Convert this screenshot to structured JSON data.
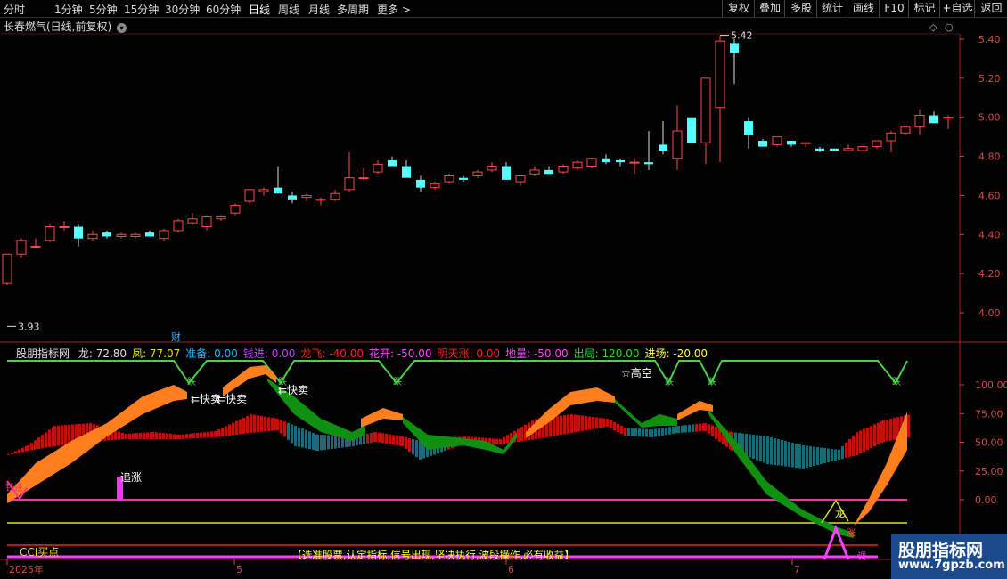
{
  "toolbar": {
    "periods": [
      "分时",
      "1分钟",
      "5分钟",
      "15分钟",
      "30分钟",
      "60分钟",
      "日线",
      "周线",
      "月线",
      "多周期",
      "更多 >"
    ],
    "active_period": "日线",
    "right_buttons": [
      "复权",
      "叠加",
      "多股",
      "统计",
      "画线",
      "F10",
      "标记",
      "+自选",
      "返回"
    ]
  },
  "stock": {
    "title": "长春燃气(日线,前复权)",
    "high_label": "5.42",
    "low_label": "3.93",
    "cai_label": "财"
  },
  "price_axis": [
    "5.40",
    "5.20",
    "5.00",
    "4.80",
    "4.60",
    "4.40",
    "4.20",
    "4.00"
  ],
  "indicator": {
    "name": "股朋指标网",
    "values": [
      {
        "label": "龙: 72.80",
        "color": "#e0e0e0"
      },
      {
        "label": "凤: 77.07",
        "color": "#e0e000"
      },
      {
        "label": "准备: 0.00",
        "color": "#00c0ff"
      },
      {
        "label": "钱进: 0.00",
        "color": "#c040ff"
      },
      {
        "label": "龙飞: -40.00",
        "color": "#ff2020"
      },
      {
        "label": "花开: -50.00",
        "color": "#ff40ff"
      },
      {
        "label": "明天涨: 0.00",
        "color": "#ff2020"
      },
      {
        "label": "地量: -50.00",
        "color": "#ff40ff"
      },
      {
        "label": "出局: 120.00",
        "color": "#20e020"
      },
      {
        "label": "进场: -20.00",
        "color": "#ffff40"
      }
    ],
    "axis": [
      "100.00",
      "75.00",
      "50.00",
      "25.00",
      "0.00"
    ],
    "annotations": {
      "kuaimai1": "快卖",
      "kuaimai2": "快卖",
      "kuaimai3": "快卖",
      "gaokong": "☆高空",
      "zhuizhang": "追涨",
      "cci": "CCI买点",
      "long": "龙",
      "zhang": "涨",
      "qian": "钱进",
      "diao": "调",
      "slogan": "【选准股票,认定指标,信号出现,坚决执行,波段操作,必有收益】"
    }
  },
  "dates": [
    "2025年",
    "5",
    "6",
    "7"
  ],
  "watermark": {
    "line1": "股朋指标网",
    "line2": "www.7gpzb.com"
  },
  "colors": {
    "up": "#ff4a4a",
    "down": "#54ffff",
    "orange": "#ff7f1f",
    "green": "#109010",
    "red_band": "#c01010",
    "teal_band": "#1a6a7a"
  },
  "chart_data": {
    "type": "candlestick",
    "ylim": [
      3.9,
      5.5
    ],
    "candles": [
      [
        4.15,
        4.3,
        4.14,
        4.3
      ],
      [
        4.3,
        4.38,
        4.28,
        4.37
      ],
      [
        4.34,
        4.38,
        4.33,
        4.34
      ],
      [
        4.37,
        4.45,
        4.36,
        4.44
      ],
      [
        4.44,
        4.47,
        4.42,
        4.44
      ],
      [
        4.44,
        4.45,
        4.34,
        4.38
      ],
      [
        4.38,
        4.42,
        4.37,
        4.4
      ],
      [
        4.41,
        4.42,
        4.38,
        4.39
      ],
      [
        4.39,
        4.41,
        4.38,
        4.4
      ],
      [
        4.39,
        4.41,
        4.38,
        4.4
      ],
      [
        4.41,
        4.42,
        4.39,
        4.39
      ],
      [
        4.38,
        4.43,
        4.37,
        4.42
      ],
      [
        4.42,
        4.48,
        4.41,
        4.47
      ],
      [
        4.46,
        4.51,
        4.45,
        4.48
      ],
      [
        4.44,
        4.49,
        4.42,
        4.49
      ],
      [
        4.48,
        4.5,
        4.47,
        4.49
      ],
      [
        4.51,
        4.56,
        4.5,
        4.55
      ],
      [
        4.57,
        4.63,
        4.56,
        4.63
      ],
      [
        4.62,
        4.64,
        4.6,
        4.63
      ],
      [
        4.64,
        4.75,
        4.61,
        4.61
      ],
      [
        4.6,
        4.62,
        4.56,
        4.58
      ],
      [
        4.59,
        4.61,
        4.57,
        4.6
      ],
      [
        4.58,
        4.59,
        4.55,
        4.58
      ],
      [
        4.58,
        4.63,
        4.57,
        4.61
      ],
      [
        4.63,
        4.82,
        4.62,
        4.69
      ],
      [
        4.69,
        4.74,
        4.68,
        4.69
      ],
      [
        4.72,
        4.78,
        4.71,
        4.76
      ],
      [
        4.78,
        4.8,
        4.76,
        4.75
      ],
      [
        4.75,
        4.78,
        4.72,
        4.69
      ],
      [
        4.68,
        4.7,
        4.62,
        4.64
      ],
      [
        4.64,
        4.67,
        4.63,
        4.66
      ],
      [
        4.67,
        4.71,
        4.66,
        4.7
      ],
      [
        4.69,
        4.7,
        4.67,
        4.68
      ],
      [
        4.7,
        4.73,
        4.69,
        4.72
      ],
      [
        4.73,
        4.77,
        4.72,
        4.75
      ],
      [
        4.75,
        4.77,
        4.7,
        4.68
      ],
      [
        4.67,
        4.7,
        4.65,
        4.7
      ],
      [
        4.71,
        4.75,
        4.7,
        4.73
      ],
      [
        4.73,
        4.75,
        4.71,
        4.71
      ],
      [
        4.72,
        4.76,
        4.71,
        4.75
      ],
      [
        4.74,
        4.78,
        4.73,
        4.77
      ],
      [
        4.75,
        4.78,
        4.74,
        4.79
      ],
      [
        4.79,
        4.81,
        4.76,
        4.77
      ],
      [
        4.78,
        4.79,
        4.75,
        4.77
      ],
      [
        4.77,
        4.79,
        4.71,
        4.77
      ],
      [
        4.77,
        4.93,
        4.73,
        4.76
      ],
      [
        4.86,
        4.98,
        4.81,
        4.83
      ],
      [
        4.79,
        5.06,
        4.73,
        4.93
      ],
      [
        5.0,
        5.0,
        4.88,
        4.87
      ],
      [
        4.87,
        5.2,
        4.76,
        5.2
      ],
      [
        5.05,
        5.42,
        4.77,
        5.39
      ],
      [
        5.38,
        5.4,
        5.17,
        5.33
      ],
      [
        4.98,
        5.0,
        4.84,
        4.91
      ],
      [
        4.88,
        4.89,
        4.86,
        4.85
      ],
      [
        4.86,
        4.9,
        4.85,
        4.9
      ],
      [
        4.88,
        4.88,
        4.85,
        4.86
      ],
      [
        4.87,
        4.86,
        4.85,
        4.87
      ],
      [
        4.84,
        4.85,
        4.82,
        4.83
      ],
      [
        4.84,
        4.84,
        4.83,
        4.83
      ],
      [
        4.83,
        4.86,
        4.83,
        4.84
      ],
      [
        4.83,
        4.85,
        4.84,
        4.85
      ],
      [
        4.85,
        4.86,
        4.84,
        4.88
      ],
      [
        4.88,
        4.93,
        4.82,
        4.92
      ],
      [
        4.92,
        4.94,
        4.91,
        4.95
      ],
      [
        4.95,
        5.04,
        4.91,
        5.01
      ],
      [
        5.01,
        5.03,
        4.97,
        4.97
      ],
      [
        5.0,
        5.01,
        4.94,
        5.0
      ]
    ]
  }
}
